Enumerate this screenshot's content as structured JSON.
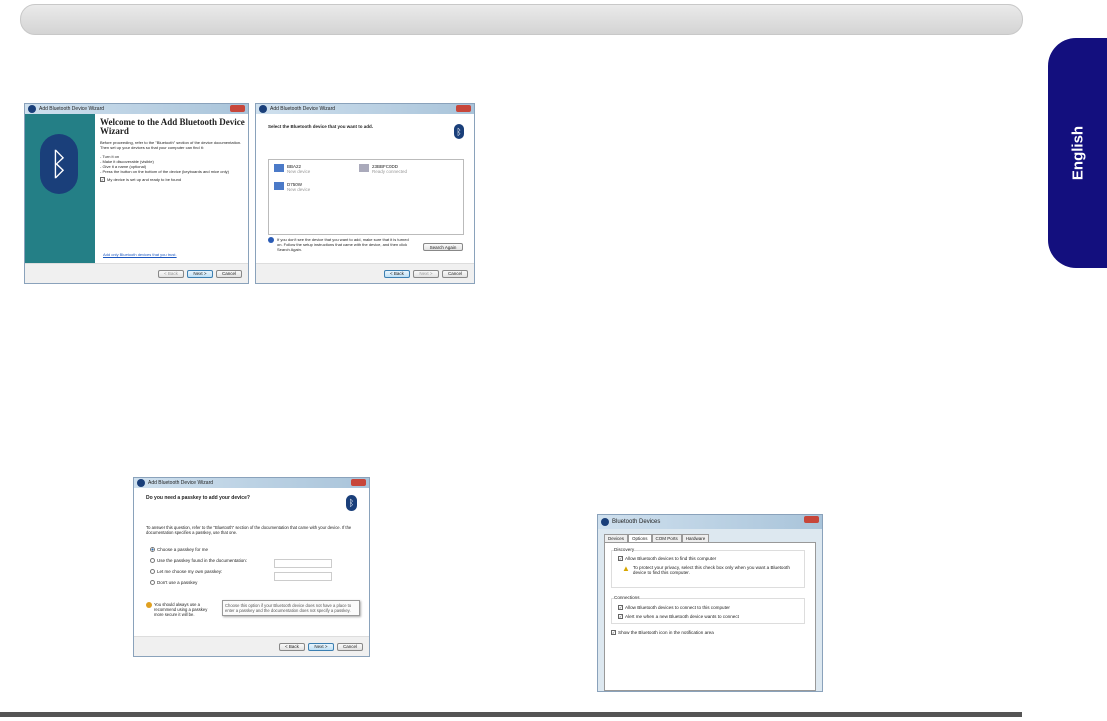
{
  "side_tab": "English",
  "wizard1": {
    "title": "Add Bluetooth Device Wizard",
    "heading": "Welcome to the Add Bluetooth Device Wizard",
    "intro": "Before proceeding, refer to the \"Bluetooth\" section of the device documentation. Then set up your devices so that your computer can find it:",
    "steps": [
      "- Turn it on",
      "- Make it discoverable (visible)",
      "- Give it a name (optional)",
      "- Press the button on the bottom of the device (keyboards and mice only)"
    ],
    "checkbox": "My device is set up and ready to be found",
    "link": "Add only Bluetooth devices that you trust.",
    "back": "< Back",
    "next": "Next >",
    "cancel": "Cancel"
  },
  "wizard2": {
    "title": "Add Bluetooth Device Wizard",
    "heading": "Select the Bluetooth device that you want to add.",
    "devices": [
      {
        "name": "BBA22",
        "status": "New device"
      },
      {
        "name": "23BBFC0DD",
        "status": "Ready connected"
      },
      {
        "name": "D750W",
        "status": "New device"
      }
    ],
    "info": "If you don't see the device that you want to add, make sure that it is turned on. Follow the setup instructions that came with the device, and then click Search Again.",
    "search_again": "Search Again",
    "back": "< Back",
    "next": "Next >",
    "cancel": "Cancel"
  },
  "wizard3": {
    "title": "Add Bluetooth Device Wizard",
    "heading": "Do you need a passkey to add your device?",
    "intro": "To answer this question, refer to the \"Bluetooth\" section of the documentation that came with your device. If the documentation specifies a passkey, use that one.",
    "options": [
      "Choose a passkey for me",
      "Use the passkey found in the documentation:",
      "Let me choose my own passkey:",
      "Don't use a passkey"
    ],
    "warning": "You should always use a passkey, unless your device does not support one. We recommend using a passkey that is 8 to 16 digits long. The longer the passkey, the more secure it will be.",
    "warning_visible_1": "You should always use a",
    "warning_visible_2": "recommend using a passkey",
    "warning_visible_3": "more secure it will be.",
    "tooltip": "Choose this option if your Bluetooth device does not have a place to enter a passkey and the documentation does not specify a passkey.",
    "back": "< Back",
    "next": "Next >",
    "cancel": "Cancel"
  },
  "bt_devices": {
    "title": "Bluetooth Devices",
    "tabs": [
      "Devices",
      "Options",
      "COM Ports",
      "Hardware"
    ],
    "discovery": "Discovery",
    "allow_find": "Allow Bluetooth devices to find this computer",
    "privacy": "To protect your privacy, select this check box only when you want a Bluetooth device to find this computer.",
    "connections": "Connections",
    "allow_connect": "Allow Bluetooth devices to connect to this computer",
    "alert": "Alert me when a new Bluetooth device wants to connect",
    "show_icon": "Show the Bluetooth icon in the notification area"
  }
}
